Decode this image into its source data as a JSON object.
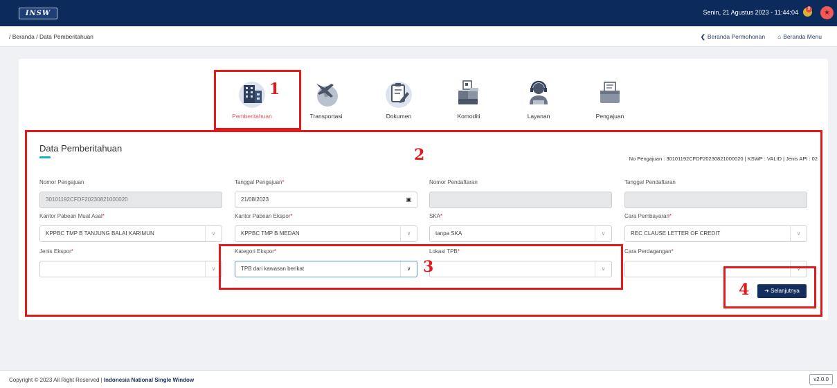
{
  "header": {
    "logo_text": "INSW",
    "datetime": "Senin, 21 Agustus 2023 - 11:44:04",
    "notification_count": "8"
  },
  "breadcrumb": "/ Beranda / Data Pemberitahuan",
  "nav": {
    "back_label": "Beranda Permohonan",
    "menu_label": "Beranda Menu"
  },
  "steps": [
    {
      "label": "Pemberitahuan",
      "icon": "building-icon",
      "active": true
    },
    {
      "label": "Transportasi",
      "icon": "airplane-globe-icon",
      "active": false
    },
    {
      "label": "Dokumen",
      "icon": "document-edit-icon",
      "active": false
    },
    {
      "label": "Komoditi",
      "icon": "boxes-icon",
      "active": false
    },
    {
      "label": "Layanan",
      "icon": "customer-service-icon",
      "active": false
    },
    {
      "label": "Pengajuan",
      "icon": "submission-box-icon",
      "active": false
    }
  ],
  "section": {
    "title": "Data Pemberitahuan",
    "info": "No Pengajuan : 30101192CFDF20230821000020 | KSWP : VALID | Jenis API : 02"
  },
  "fields": {
    "nomor_pengajuan": {
      "label": "Nomor Pengajuan",
      "value": "30101192CFDF20230821000020"
    },
    "tanggal_pengajuan": {
      "label": "Tanggal Pengajuan",
      "value": "21/08/2023"
    },
    "nomor_pendaftaran": {
      "label": "Nomor Pendaftaran",
      "value": ""
    },
    "tanggal_pendaftaran": {
      "label": "Tanggal Pendaftaran",
      "value": ""
    },
    "kantor_muat": {
      "label": "Kantor Pabean Muat Asal",
      "value": "KPPBC TMP B TANJUNG BALAI KARIMUN"
    },
    "kantor_ekspor": {
      "label": "Kantor Pabean Ekspor",
      "value": "KPPBC TMP B MEDAN"
    },
    "ska": {
      "label": "SKA",
      "value": "tanpa SKA"
    },
    "cara_pembayaran": {
      "label": "Cara Pembayaran",
      "value": "REC CLAUSE LETTER OF CREDIT"
    },
    "jenis_ekspor": {
      "label": "Jenis Ekspor",
      "value": ""
    },
    "kategori_ekspor": {
      "label": "Kategori Ekspor",
      "value": "TPB dari kawasan berikat"
    },
    "lokasi_tpb": {
      "label": "Lokasi TPB",
      "value": ""
    },
    "cara_perdagangan": {
      "label": "Cara Perdagangan",
      "value": ""
    }
  },
  "next_button": "Selanjutnya",
  "annotations": [
    "1",
    "2",
    "3",
    "4"
  ],
  "footer": {
    "copyright": "Copyright © 2023 All Right Reserved | ",
    "org": "Indonesia National Single Window",
    "version": "v2.0.0"
  },
  "colors": {
    "topbar": "#0c2a5c",
    "accent_red": "#e21a1a",
    "active_step": "#e05a5a",
    "button": "#142f5e"
  }
}
